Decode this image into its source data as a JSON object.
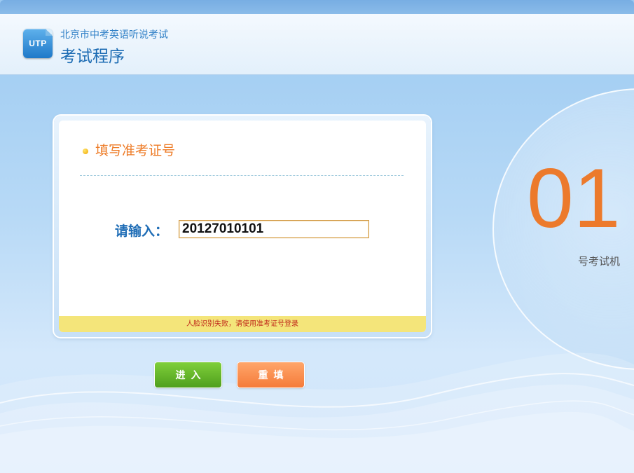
{
  "header": {
    "logo_text": "UTP",
    "subtitle": "北京市中考英语听说考试",
    "title": "考试程序"
  },
  "login_panel": {
    "title": "填写准考证号",
    "field_label": "请输入：",
    "exam_id_value": "20127010101",
    "footer_message": "人脸识别失败，请使用准考证号登录"
  },
  "machine": {
    "number": "01",
    "label": "号考试机"
  },
  "buttons": {
    "enter_label": "进入",
    "reset_label": "重填"
  },
  "colors": {
    "accent_orange": "#ec7a2c",
    "title_blue": "#1b6bb3",
    "enter_green": "#5fb02a",
    "reset_orange": "#f88d4d",
    "footer_yellow": "#f4e57a",
    "error_red": "#c0281a"
  }
}
